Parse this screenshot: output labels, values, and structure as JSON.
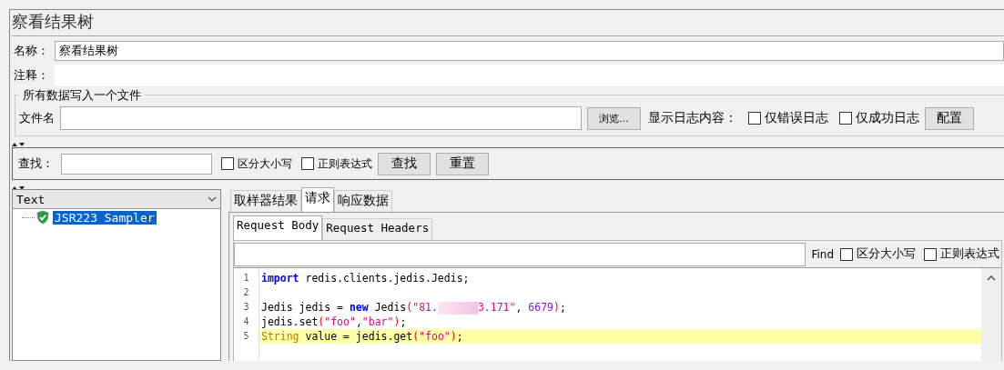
{
  "title": "察看结果树",
  "name_field": {
    "label": "名称：",
    "value": "察看结果树"
  },
  "comment_field": {
    "label": "注释："
  },
  "file_group": {
    "legend": "所有数据写入一个文件",
    "label": "文件名",
    "browse_button": "浏览...",
    "log_label": "显示日志内容：",
    "checkboxes": [
      {
        "label": "仅错误日志",
        "checked": false
      },
      {
        "label": "仅成功日志",
        "checked": false
      }
    ],
    "config_button": "配置"
  },
  "search": {
    "label": "查找：",
    "checkboxes": [
      {
        "label": "区分大小写",
        "checked": false
      },
      {
        "label": "正则表达式",
        "checked": false
      }
    ],
    "buttons": [
      "查找",
      "重置"
    ]
  },
  "renderer_select": {
    "value": "Text"
  },
  "tree": [
    {
      "label": "JSR223 Sampler",
      "selected": true
    }
  ],
  "tabs": [
    {
      "label": "取样器结果",
      "selected": false
    },
    {
      "label": "请求",
      "selected": true
    },
    {
      "label": "响应数据",
      "selected": false
    }
  ],
  "sub_tabs": [
    {
      "label": "Request Body",
      "selected": true
    },
    {
      "label": "Request Headers",
      "selected": false
    }
  ],
  "find_bar": {
    "label": "Find",
    "checkboxes": [
      {
        "label": "区分大小写",
        "checked": false
      },
      {
        "label": "正则表达式",
        "checked": false
      }
    ]
  },
  "code": {
    "lines": [
      {
        "number": "1",
        "highlighted": false,
        "tokens": [
          {
            "kind": "keyword",
            "text": "import"
          },
          {
            "kind": "plain",
            "text": " redis.clients.jedis.Jedis;"
          }
        ]
      },
      {
        "number": "2",
        "highlighted": false
      },
      {
        "number": "3",
        "highlighted": false,
        "tokens": [
          {
            "kind": "plain",
            "text": "Jedis jedis = "
          },
          {
            "kind": "keyword",
            "text": "new"
          },
          {
            "kind": "plain",
            "text": " Jedis"
          },
          {
            "kind": "paren",
            "text": "("
          },
          {
            "kind": "string",
            "text": "\"81."
          },
          {
            "kind": "redaction"
          },
          {
            "kind": "string",
            "text": "3.171\""
          },
          {
            "kind": "plain",
            "text": ", "
          },
          {
            "kind": "number",
            "text": "6679"
          },
          {
            "kind": "paren",
            "text": ")"
          },
          {
            "kind": "plain",
            "text": ";"
          }
        ]
      },
      {
        "number": "4",
        "highlighted": false,
        "tokens": [
          {
            "kind": "plain",
            "text": "jedis.set"
          },
          {
            "kind": "paren",
            "text": "("
          },
          {
            "kind": "string",
            "text": "\"foo\""
          },
          {
            "kind": "plain",
            "text": ","
          },
          {
            "kind": "string",
            "text": "\"bar\""
          },
          {
            "kind": "paren",
            "text": ")"
          },
          {
            "kind": "plain",
            "text": ";"
          }
        ]
      },
      {
        "number": "5",
        "highlighted": true,
        "tokens": [
          {
            "kind": "type",
            "text": "String"
          },
          {
            "kind": "plain",
            "text": " value = jedis.get"
          },
          {
            "kind": "paren",
            "text": "("
          },
          {
            "kind": "string",
            "text": "\"foo\""
          },
          {
            "kind": "paren",
            "text": ")"
          },
          {
            "kind": "plain",
            "text": ";"
          }
        ]
      }
    ]
  }
}
